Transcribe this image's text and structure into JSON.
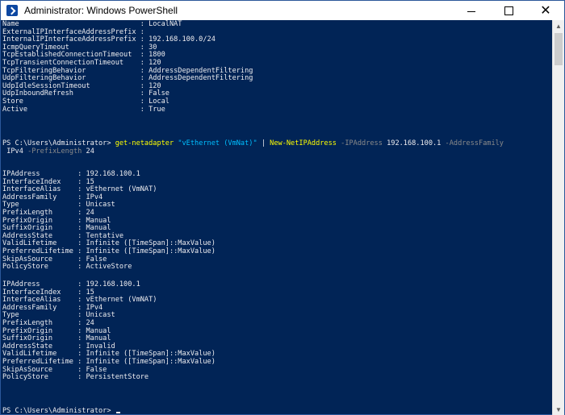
{
  "window": {
    "title": "Administrator: Windows PowerShell",
    "icon": "powershell-icon",
    "controls": {
      "minimize": "minimize-icon",
      "maximize": "maximize-icon",
      "close": "close-icon"
    }
  },
  "colors": {
    "background": "#012456",
    "text": "#eeedf0",
    "command": "#ffff00",
    "string": "#00bfff",
    "parameter": "#8a8a8a"
  },
  "console": {
    "nat_output": [
      "Name                             : LocalNAT",
      "ExternalIPInterfaceAddressPrefix :",
      "InternalIPInterfaceAddressPrefix : 192.168.100.0/24",
      "IcmpQueryTimeout                 : 30",
      "TcpEstablishedConnectionTimeout  : 1800",
      "TcpTransientConnectionTimeout    : 120",
      "TcpFilteringBehavior             : AddressDependentFiltering",
      "UdpFilteringBehavior             : AddressDependentFiltering",
      "UdpIdleSessionTimeout            : 120",
      "UdpInboundRefresh                : False",
      "Store                            : Local",
      "Active                           : True"
    ],
    "command": {
      "prompt": "PS C:\\Users\\Administrator> ",
      "cmdlet1": "get-netadapter",
      "arg1": "\"vEthernet (VmNat)\"",
      "pipe": " | ",
      "cmdlet2": "New-NetIPAddress",
      "param1": "-IPAddress",
      "value1": "192.168.100.1",
      "param2": "-AddressFamily",
      "value2": "IPv4",
      "param3": "-PrefixLength",
      "value3": "24"
    },
    "ip_output_1": [
      "IPAddress         : 192.168.100.1",
      "InterfaceIndex    : 15",
      "InterfaceAlias    : vEthernet (VmNAT)",
      "AddressFamily     : IPv4",
      "Type              : Unicast",
      "PrefixLength      : 24",
      "PrefixOrigin      : Manual",
      "SuffixOrigin      : Manual",
      "AddressState      : Tentative",
      "ValidLifetime     : Infinite ([TimeSpan]::MaxValue)",
      "PreferredLifetime : Infinite ([TimeSpan]::MaxValue)",
      "SkipAsSource      : False",
      "PolicyStore       : ActiveStore"
    ],
    "ip_output_2": [
      "IPAddress         : 192.168.100.1",
      "InterfaceIndex    : 15",
      "InterfaceAlias    : vEthernet (VmNAT)",
      "AddressFamily     : IPv4",
      "Type              : Unicast",
      "PrefixLength      : 24",
      "PrefixOrigin      : Manual",
      "SuffixOrigin      : Manual",
      "AddressState      : Invalid",
      "ValidLifetime     : Infinite ([TimeSpan]::MaxValue)",
      "PreferredLifetime : Infinite ([TimeSpan]::MaxValue)",
      "SkipAsSource      : False",
      "PolicyStore       : PersistentStore"
    ],
    "final_prompt": "PS C:\\Users\\Administrator> "
  }
}
